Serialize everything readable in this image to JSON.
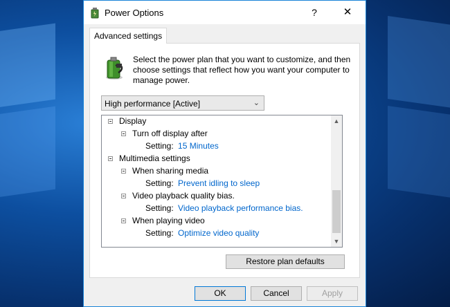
{
  "window": {
    "title": "Power Options",
    "help_glyph": "?",
    "close_glyph": "✕"
  },
  "tab": {
    "label": "Advanced settings"
  },
  "description": "Select the power plan that you want to customize, and then choose settings that reflect how you want your computer to manage power.",
  "plan_select": {
    "value": "High performance [Active]"
  },
  "tree": {
    "display": {
      "label": "Display",
      "turn_off": {
        "label": "Turn off display after",
        "setting_label": "Setting:",
        "value": "15 Minutes"
      }
    },
    "multimedia": {
      "label": "Multimedia settings",
      "sharing": {
        "label": "When sharing media",
        "setting_label": "Setting:",
        "value": "Prevent idling to sleep"
      },
      "playback_bias": {
        "label": "Video playback quality bias.",
        "setting_label": "Setting:",
        "value": "Video playback performance bias."
      },
      "playing_video": {
        "label": "When playing video",
        "setting_label": "Setting:",
        "value": "Optimize video quality"
      }
    }
  },
  "buttons": {
    "restore": "Restore plan defaults",
    "ok": "OK",
    "cancel": "Cancel",
    "apply": "Apply"
  },
  "colors": {
    "link": "#0066cc",
    "accent": "#0078d7"
  }
}
